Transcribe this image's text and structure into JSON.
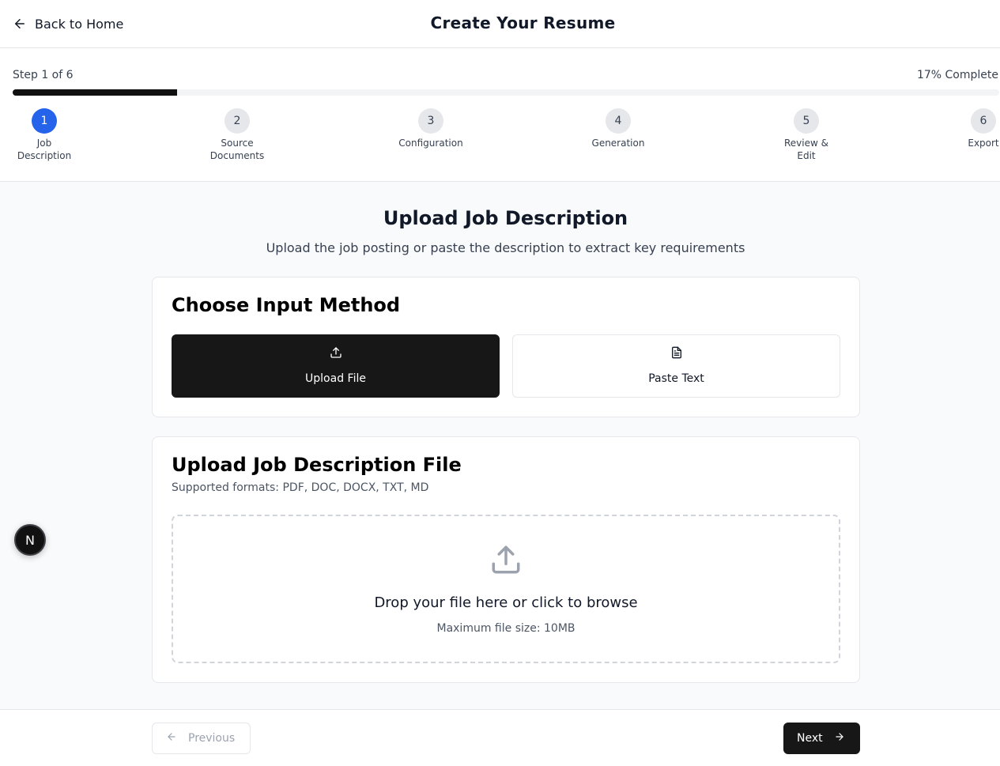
{
  "header": {
    "back_label": "Back to Home",
    "title": "Create Your Resume"
  },
  "progress": {
    "step_text": "Step 1 of 6",
    "percent_text": "17% Complete",
    "fraction": 0.1667,
    "steps": [
      {
        "number": "1",
        "label": "Job Description",
        "active": true
      },
      {
        "number": "2",
        "label": "Source Documents",
        "active": false
      },
      {
        "number": "3",
        "label": "Configuration",
        "active": false
      },
      {
        "number": "4",
        "label": "Generation",
        "active": false
      },
      {
        "number": "5",
        "label": "Review & Edit",
        "active": false
      },
      {
        "number": "6",
        "label": "Export",
        "active": false
      }
    ]
  },
  "main": {
    "title": "Upload Job Description",
    "subtitle": "Upload the job posting or paste the description to extract key requirements",
    "input_method": {
      "title": "Choose Input Method",
      "upload_label": "Upload File",
      "paste_label": "Paste Text",
      "selected": "upload"
    },
    "upload": {
      "title": "Upload Job Description File",
      "formats": "Supported formats: PDF, DOC, DOCX, TXT, MD",
      "drop_text": "Drop your file here or click to browse",
      "max_size": "Maximum file size: 10MB"
    }
  },
  "footer": {
    "prev_label": "Previous",
    "next_label": "Next",
    "prev_disabled": true
  },
  "badge": {
    "letter": "N"
  },
  "colors": {
    "accent": "#2563eb",
    "primary": "#171717",
    "border": "#e5e7eb",
    "muted": "#9ca3af"
  },
  "icons": [
    "arrow-left-icon",
    "upload-icon",
    "file-text-icon",
    "arrow-right-icon"
  ]
}
